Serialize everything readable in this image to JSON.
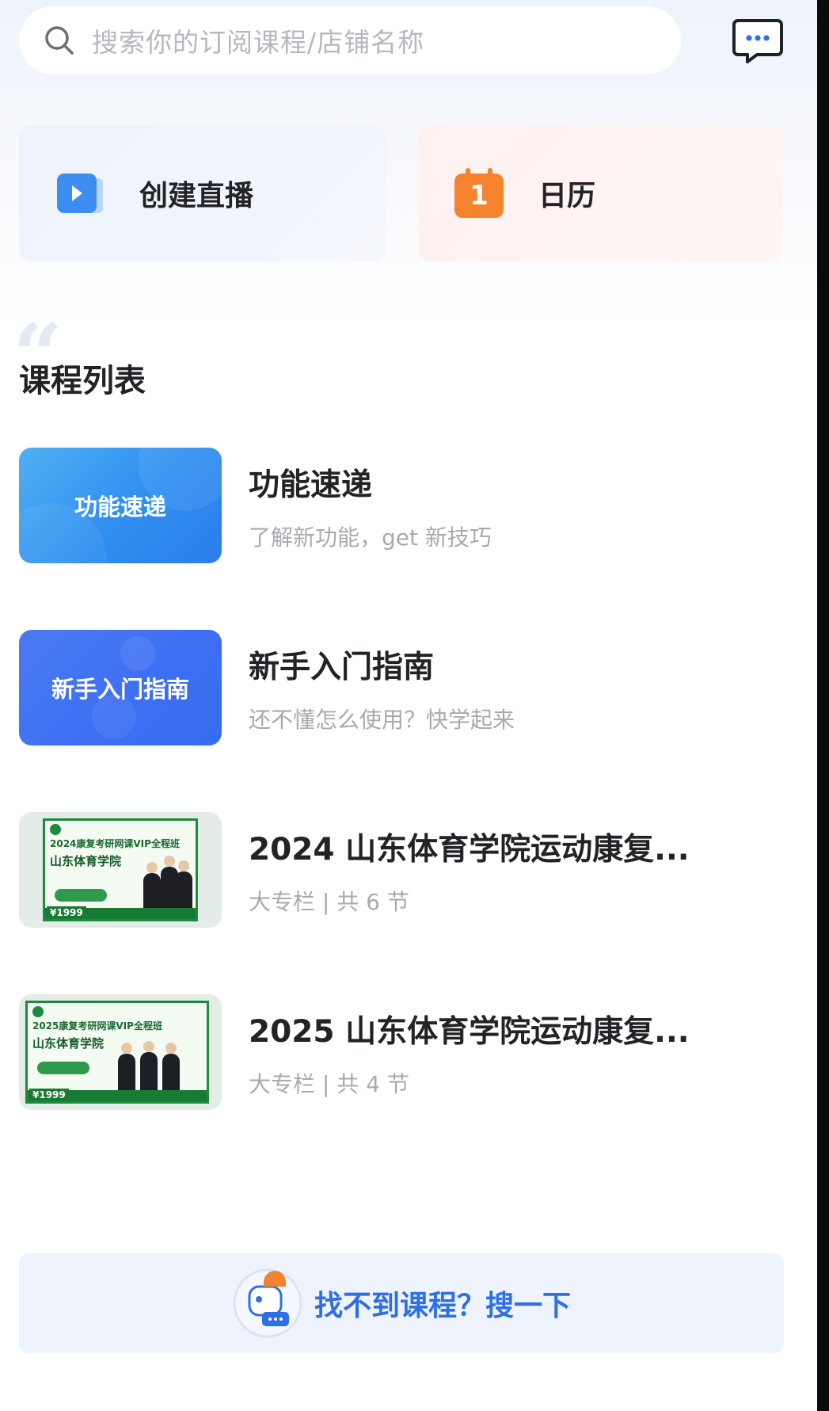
{
  "search": {
    "placeholder": "搜索你的订阅课程/店铺名称"
  },
  "quick_actions": {
    "create_live": "创建直播",
    "calendar": "日历",
    "calendar_day": "1"
  },
  "section": {
    "title": "课程列表"
  },
  "courses": [
    {
      "thumb_text": "功能速递",
      "title": "功能速递",
      "subtitle": "了解新功能，get 新技巧"
    },
    {
      "thumb_text": "新手入门指南",
      "title": "新手入门指南",
      "subtitle": "还不懂怎么使用？快学起来"
    },
    {
      "poster_head": "2024康复考研网课VIP全程班",
      "poster_school": "山东体育学院",
      "poster_price": "¥1999",
      "title": "2024 山东体育学院运动康复...",
      "subtitle": "大专栏 | 共 6 节"
    },
    {
      "poster_head": "2025康复考研网课VIP全程班",
      "poster_school": "山东体育学院",
      "poster_price": "¥1999",
      "title": "2025 山东体育学院运动康复...",
      "subtitle": "大专栏 | 共 4 节"
    }
  ],
  "help": {
    "text": "找不到课程？搜一下"
  },
  "colors": {
    "accent_blue": "#2f6fe6",
    "live_icon_blue": "#3e8df2",
    "calendar_orange": "#f5832e",
    "poster_green": "#1e8a3d"
  }
}
